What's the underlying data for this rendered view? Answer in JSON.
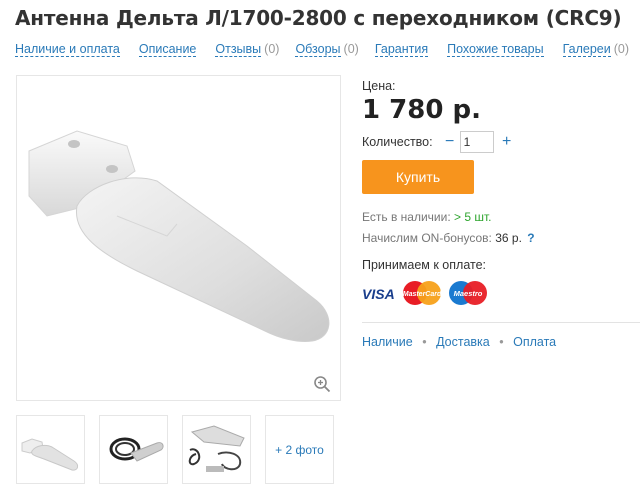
{
  "product": {
    "title": "Антенна Дельта Л/1700-2800 с переходником (CRC9)"
  },
  "tabs": [
    {
      "label": "Наличие и оплата",
      "count": ""
    },
    {
      "label": "Описание",
      "count": ""
    },
    {
      "label": "Отзывы",
      "count": "(0)"
    },
    {
      "label": "Обзоры",
      "count": "(0)"
    },
    {
      "label": "Гарантия",
      "count": ""
    },
    {
      "label": "Похожие товары",
      "count": ""
    },
    {
      "label": "Галереи",
      "count": "(0)"
    }
  ],
  "gallery": {
    "more_label": "+ 2 фото"
  },
  "purchase": {
    "price_label": "Цена:",
    "price": "1 780 р.",
    "qty_label": "Количество:",
    "qty_minus": "−",
    "qty_value": "1",
    "qty_plus": "+",
    "buy_label": "Купить",
    "stock_label": "Есть в наличии:",
    "stock_value": "> 5 шт.",
    "bonus_label": "Начислим ON-бонусов:",
    "bonus_value": "36 р.",
    "bonus_help": "?",
    "pay_label": "Принимаем к оплате:",
    "visa_label": "VISA",
    "mastercard_label": "MasterCard",
    "maestro_label": "Maestro"
  },
  "info_links": {
    "availability": "Наличие",
    "delivery": "Доставка",
    "payment": "Оплата",
    "separator": "•"
  },
  "colors": {
    "accent": "#2a7ab8",
    "buy_button": "#f7941d",
    "in_stock": "#2ea52e"
  }
}
